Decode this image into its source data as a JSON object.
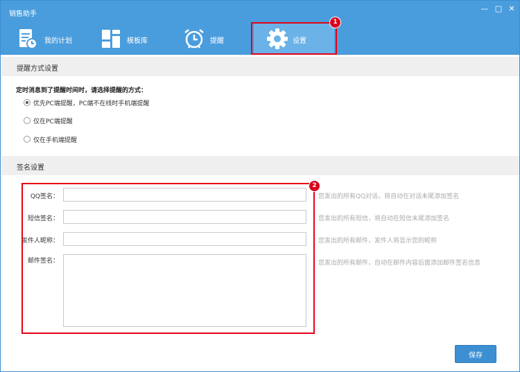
{
  "window": {
    "title": "销售助手",
    "controls": [
      "minimize-icon",
      "maximize-icon",
      "close-icon"
    ]
  },
  "nav": {
    "tabs": [
      {
        "label": "我的计划",
        "icon": "plan-calendar-icon"
      },
      {
        "label": "模板库",
        "icon": "template-grid-icon"
      },
      {
        "label": "提醒",
        "icon": "alarm-clock-icon"
      },
      {
        "label": "设置",
        "icon": "gear-icon",
        "active": true
      }
    ]
  },
  "annotations": {
    "badge1": "1",
    "badge2": "2"
  },
  "reminder": {
    "header": "提醒方式设置",
    "prompt": "定时消息到了提醒时间时，请选择提醒的方式：",
    "options": [
      {
        "label": "优先PC端提醒，PC端不在线时手机端提醒",
        "checked": true
      },
      {
        "label": "仅在PC端提醒",
        "checked": false
      },
      {
        "label": "仅在手机端提醒",
        "checked": false
      }
    ]
  },
  "signature": {
    "header": "签名设置",
    "fields": [
      {
        "label": "QQ签名：",
        "value": "",
        "hint": "您发出的所有QQ对话，将自动在对话末尾添加签名"
      },
      {
        "label": "短信签名：",
        "value": "",
        "hint": "您发出的所有短信，将自动在短信末尾添加签名"
      },
      {
        "label": "发件人昵称：",
        "value": "",
        "hint": "您发出的所有邮件，发件人将显示您的昵称"
      },
      {
        "label": "邮件签名：",
        "value": "",
        "hint": "您发出的所有邮件，自动在邮件内容后面添加邮件签名信息"
      }
    ]
  },
  "actions": {
    "save_label": "保存"
  },
  "colors": {
    "titlebar": "#4a9ddc",
    "active_tab": "#6ab2e8",
    "highlight": "#e60012",
    "button": "#3c8fd2"
  }
}
